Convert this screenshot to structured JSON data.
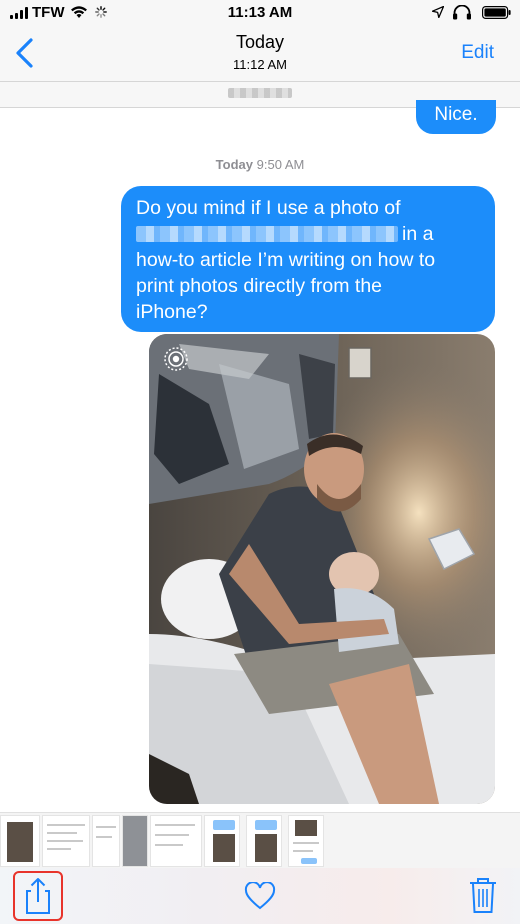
{
  "status": {
    "carrier": "TFW",
    "time": "11:13 AM"
  },
  "nav": {
    "title": "Today",
    "subtitle": "11:12 AM",
    "edit_label": "Edit"
  },
  "conversation": {
    "previous_message": "Nice.",
    "timestamp_day": "Today",
    "timestamp_time": "9:50 AM",
    "message_lines": [
      "Do you mind if I use a photo of",
      "in a",
      "how-to article I’m writing on how to",
      "print photos directly from the",
      "iPhone?"
    ]
  },
  "toolbar": {
    "share_icon": "share-icon",
    "heart_icon": "heart-icon",
    "trash_icon": "trash-icon"
  },
  "colors": {
    "accent": "#1a82fb",
    "bubble": "#1c8dfa",
    "highlight": "#e8342b"
  }
}
